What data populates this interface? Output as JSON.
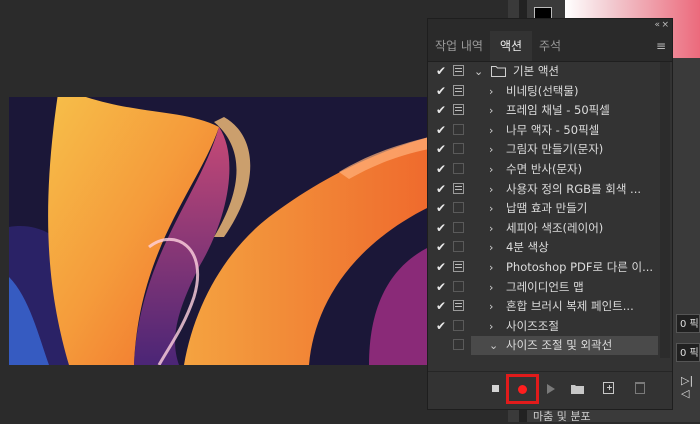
{
  "panel": {
    "tabs": [
      {
        "label": "작업 내역",
        "active": false
      },
      {
        "label": "액션",
        "active": true
      },
      {
        "label": "주석",
        "active": false
      }
    ],
    "collapse_label": "«",
    "close_label": "×",
    "menu_label": "≡",
    "actions": [
      {
        "checked": true,
        "dialog": true,
        "chevron": "⌄",
        "type": "set",
        "label": "기본 액션"
      },
      {
        "checked": true,
        "dialog": true,
        "chevron": "›",
        "type": "action",
        "label": "비네팅(선택물)"
      },
      {
        "checked": true,
        "dialog": true,
        "chevron": "›",
        "type": "action",
        "label": "프레임 채널 - 50픽셀"
      },
      {
        "checked": true,
        "dialog": false,
        "chevron": "›",
        "type": "action",
        "label": "나무 액자 - 50픽셀"
      },
      {
        "checked": true,
        "dialog": false,
        "chevron": "›",
        "type": "action",
        "label": "그림자 만들기(문자)"
      },
      {
        "checked": true,
        "dialog": false,
        "chevron": "›",
        "type": "action",
        "label": "수면 반사(문자)"
      },
      {
        "checked": true,
        "dialog": true,
        "chevron": "›",
        "type": "action",
        "label": "사용자 정의 RGB를 회색 ..."
      },
      {
        "checked": true,
        "dialog": false,
        "chevron": "›",
        "type": "action",
        "label": "납땜 효과 만들기"
      },
      {
        "checked": true,
        "dialog": false,
        "chevron": "›",
        "type": "action",
        "label": "세피아 색조(레이어)"
      },
      {
        "checked": true,
        "dialog": false,
        "chevron": "›",
        "type": "action",
        "label": "4분 색상"
      },
      {
        "checked": true,
        "dialog": true,
        "chevron": "›",
        "type": "action",
        "label": "Photoshop PDF로 다른 이..."
      },
      {
        "checked": true,
        "dialog": false,
        "chevron": "›",
        "type": "action",
        "label": "그레이디언트 맵"
      },
      {
        "checked": true,
        "dialog": true,
        "chevron": "›",
        "type": "action",
        "label": "혼합 브러시 복제 페인트..."
      },
      {
        "checked": true,
        "dialog": false,
        "chevron": "›",
        "type": "action",
        "label": "사이즈조절"
      },
      {
        "checked": false,
        "dialog": false,
        "chevron": "⌄",
        "type": "action",
        "label": "사이즈 조절 및 외곽선",
        "selected": true
      }
    ],
    "check_mark": "✔",
    "bottom_buttons": [
      "stop",
      "record",
      "play",
      "new-set",
      "new-action",
      "delete"
    ]
  },
  "right_panel": {
    "field_prefix_1": "0 픽",
    "field_prefix_2": "0 픽",
    "icon_text": "▷|◁",
    "bottom_label": "마춤 및 분포"
  },
  "colors": {
    "record_highlight": "#e11b1b",
    "record_dot": "#ff1e1e"
  }
}
